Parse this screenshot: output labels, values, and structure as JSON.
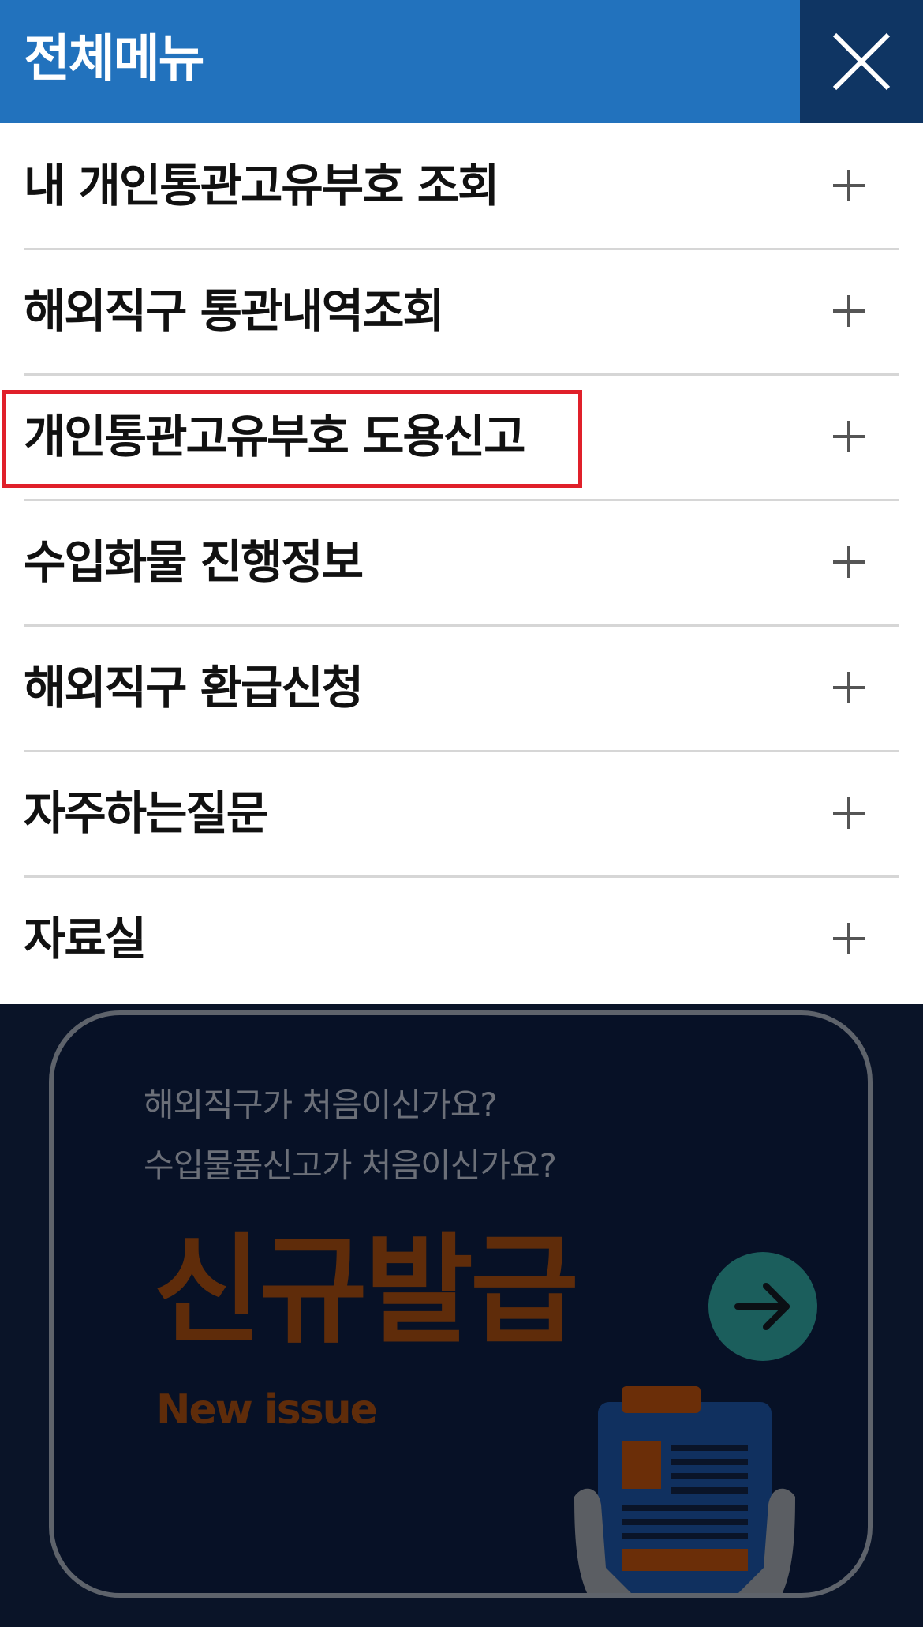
{
  "header": {
    "title": "전체메뉴",
    "close_icon": "close-icon",
    "background_color": "#2272bd",
    "close_background_color": "#0f3563"
  },
  "menu": {
    "items": [
      {
        "label": "내 개인통관고유부호 조회",
        "icon": "plus-icon"
      },
      {
        "label": "해외직구 통관내역조회",
        "icon": "plus-icon"
      },
      {
        "label": "개인통관고유부호 도용신고",
        "icon": "plus-icon",
        "highlighted": true
      },
      {
        "label": "수입화물 진행정보",
        "icon": "plus-icon"
      },
      {
        "label": "해외직구 환급신청",
        "icon": "plus-icon"
      },
      {
        "label": "자주하는질문",
        "icon": "plus-icon"
      },
      {
        "label": "자료실",
        "icon": "plus-icon"
      }
    ],
    "highlight_color": "#e0202a"
  },
  "banner": {
    "line1": "해외직구가 처음이신가요?",
    "line2": "수입물품신고가 처음이신가요?",
    "title": "신규발급",
    "subtitle": "New issue",
    "arrow_icon": "arrow-right-icon",
    "illustration_icon": "clipboard-icon",
    "accent_color": "#5f2c0a"
  }
}
